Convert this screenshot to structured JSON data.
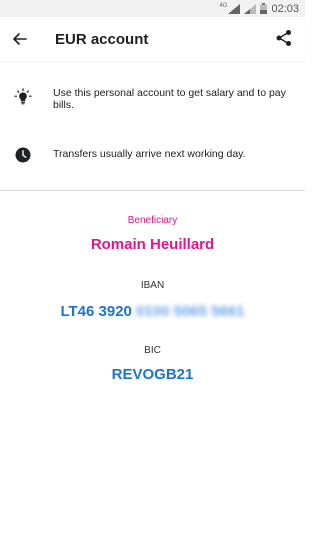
{
  "status_bar": {
    "network": "4G",
    "time": "02:03"
  },
  "header": {
    "title": "EUR account"
  },
  "info": [
    {
      "icon": "lightbulb-icon",
      "text": "Use this personal account to get salary and to pay bills."
    },
    {
      "icon": "clock-icon",
      "text": "Transfers usually arrive next working day."
    }
  ],
  "details": {
    "beneficiary_label": "Beneficiary",
    "beneficiary_name": "Romain Heuillard",
    "iban_label": "IBAN",
    "iban_visible": "LT46 3920",
    "iban_hidden": "0100 5065 5661",
    "bic_label": "BIC",
    "bic_value": "REVOGB21"
  },
  "colors": {
    "accent_pink": "#e0168a",
    "accent_blue": "#1e72d2"
  }
}
